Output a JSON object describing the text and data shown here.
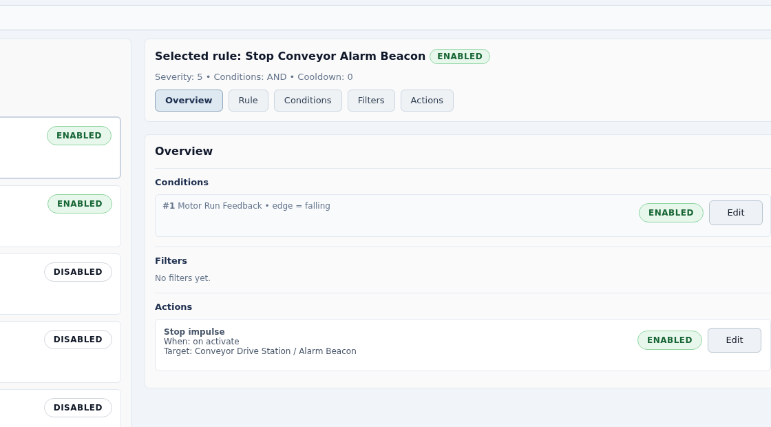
{
  "rule_list": [
    {
      "status": "ENABLED",
      "enabled": true,
      "selected": true
    },
    {
      "status": "ENABLED",
      "enabled": true,
      "selected": false
    },
    {
      "status": "DISABLED",
      "enabled": false,
      "selected": false
    },
    {
      "status": "DISABLED",
      "enabled": false,
      "selected": false
    },
    {
      "status": "DISABLED",
      "enabled": false,
      "selected": false
    }
  ],
  "header": {
    "title": "Selected rule: Stop Conveyor Alarm Beacon",
    "status": "ENABLED",
    "enabled": true,
    "summary": "Severity: 5 • Conditions: AND • Cooldown: 0",
    "tabs": [
      {
        "label": "Overview",
        "selected": true
      },
      {
        "label": "Rule",
        "selected": false
      },
      {
        "label": "Conditions",
        "selected": false
      },
      {
        "label": "Filters",
        "selected": false
      },
      {
        "label": "Actions",
        "selected": false
      }
    ]
  },
  "overview": {
    "title": "Overview",
    "conditions": {
      "heading": "Conditions",
      "items": [
        {
          "text": "**#1** Motor Run Feedback • edge = falling",
          "status": "ENABLED",
          "enabled": true,
          "button": "Edit"
        }
      ]
    },
    "filters": {
      "heading": "Filters",
      "empty": "No filters yet."
    },
    "actions": {
      "heading": "Actions",
      "items": [
        {
          "title": "Stop impulse",
          "lines": [
            "When: on activate",
            "Target: Conveyor Drive Station / Alarm Beacon"
          ],
          "status": "ENABLED",
          "enabled": true,
          "button": "Edit"
        }
      ]
    }
  }
}
